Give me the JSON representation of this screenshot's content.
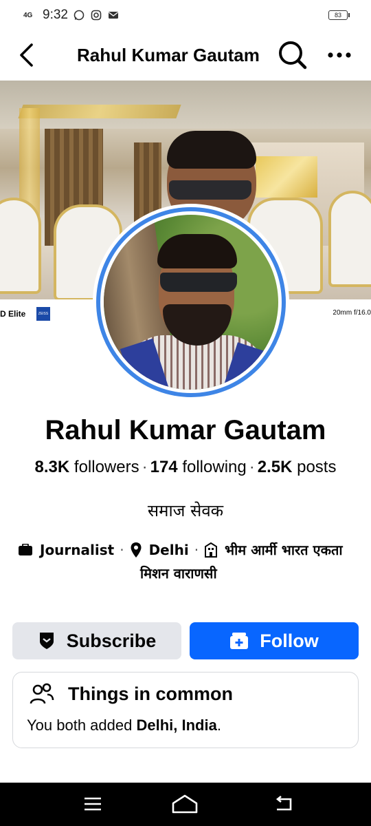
{
  "status_bar": {
    "network": "4G",
    "time": "9:32",
    "icons": [
      "whatsapp-icon",
      "instagram-icon",
      "mail-icon"
    ],
    "battery": "83"
  },
  "header": {
    "title": "Rahul Kumar Gautam",
    "icons": [
      "back-arrow-icon",
      "search-icon",
      "more-icon"
    ]
  },
  "cover": {
    "watermark_left": "D Elite",
    "watermark_brand": "ZEISS",
    "watermark_right": "20mm  f/16.0"
  },
  "profile": {
    "name": "Rahul Kumar Gautam",
    "followers_count": "8.3K",
    "followers_label": "followers",
    "following_count": "174",
    "following_label": "following",
    "posts_count": "2.5K",
    "posts_label": "posts",
    "bio": "समाज सेवक",
    "details": {
      "work": "Journalist",
      "location": "Delhi",
      "org_line1": "भीम आर्मी भारत एकता",
      "org_line2": "मिशन वाराणसी"
    }
  },
  "actions": {
    "subscribe_label": "Subscribe",
    "follow_label": "Follow",
    "follow_color": "#0866ff"
  },
  "common": {
    "title": "Things in common",
    "text_prefix": "You both added ",
    "text_bold": "Delhi, India",
    "text_suffix": "."
  },
  "nav": {
    "icons": [
      "menu-icon",
      "home-icon",
      "back-icon"
    ]
  }
}
